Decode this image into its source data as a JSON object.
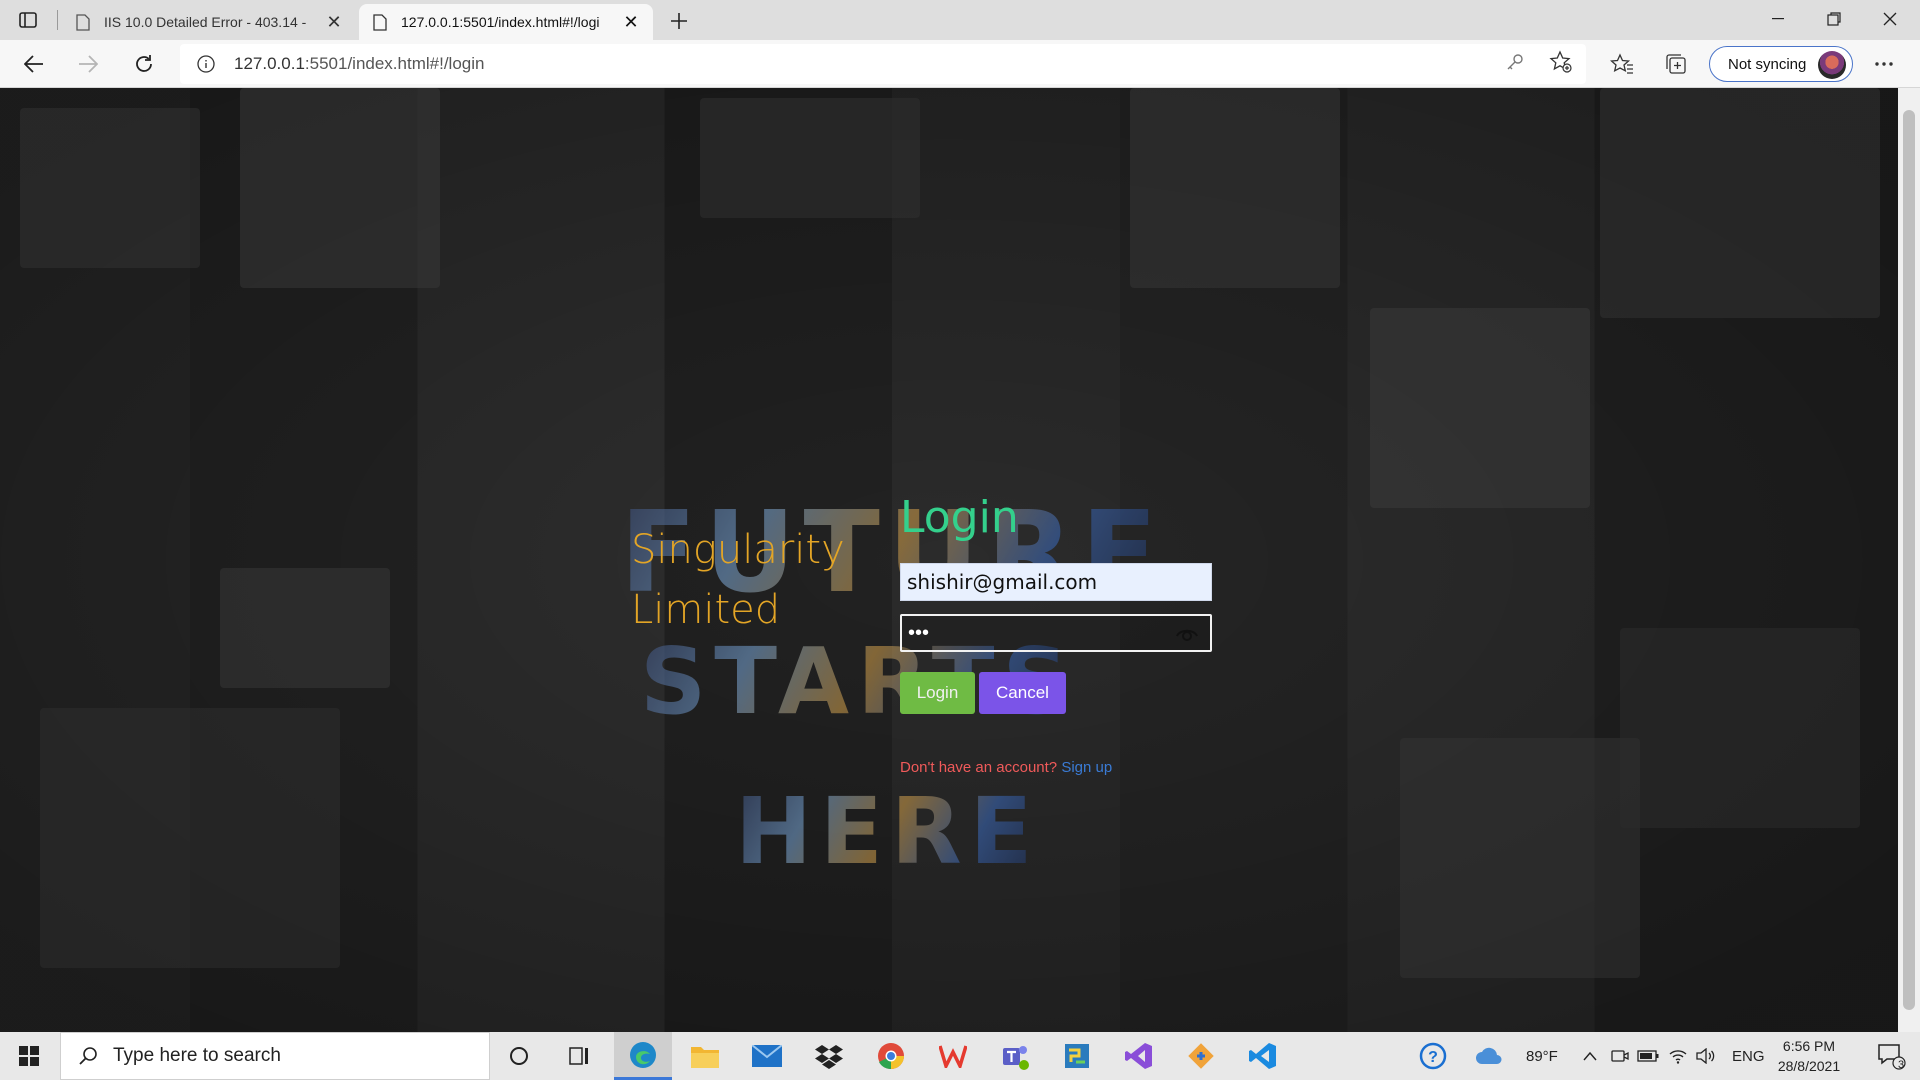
{
  "browser": {
    "tabs": [
      {
        "title": "IIS 10.0 Detailed Error - 403.14 -",
        "active": false
      },
      {
        "title": "127.0.0.1:5501/index.html#!/logi",
        "active": true
      }
    ],
    "address": {
      "host": "127.0.0.1",
      "rest": ":5501/index.html#!/login"
    },
    "sync_label": "Not syncing"
  },
  "page": {
    "brand_line1": "Singularity",
    "brand_line2": "Limited",
    "login_heading": "Login",
    "email_value": "shishir@gmail.com",
    "password_value": "•••",
    "login_button": "Login",
    "cancel_button": "Cancel",
    "signup_question": "Don't have an account?",
    "signup_link": "Sign up",
    "poster_words": [
      "FUTURE",
      "STARTS",
      "HERE"
    ],
    "colors": {
      "brand": "#e3a526",
      "heading": "#34d08c",
      "login_btn": "#6fbb44",
      "cancel_btn": "#7b54e8",
      "question": "#f05a5a",
      "link": "#3a7bd5"
    }
  },
  "taskbar": {
    "search_placeholder": "Type here to search",
    "weather": "89°F",
    "language": "ENG",
    "time": "6:56 PM",
    "date": "28/8/2021",
    "notifications": "3",
    "apps": [
      "cortana-icon",
      "task-view-icon",
      "edge-icon",
      "file-explorer-icon",
      "mail-icon",
      "dropbox-icon",
      "chrome-icon",
      "wps-icon",
      "teams-icon",
      "python-icon",
      "visual-studio-icon",
      "git-icon",
      "vscode-icon"
    ]
  }
}
